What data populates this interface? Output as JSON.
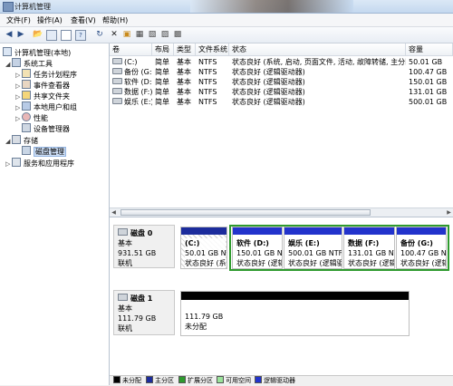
{
  "window": {
    "title": "计算机管理"
  },
  "menu": [
    "文件(F)",
    "操作(A)",
    "查看(V)",
    "帮助(H)"
  ],
  "toolbar": {
    "icons": [
      "back-icon",
      "forward-icon",
      "up-icon",
      "show-tree-icon",
      "properties-icon",
      "help-icon",
      "refresh-icon",
      "delete-icon",
      "folder-icon",
      "open-icon",
      "copy-icon",
      "cut-icon",
      "settings-icon"
    ]
  },
  "tree": {
    "root": "计算机管理(本地)",
    "system_tools": "系统工具",
    "items": [
      "任务计划程序",
      "事件查看器",
      "共享文件夹",
      "本地用户和组",
      "性能",
      "设备管理器"
    ],
    "storage": "存储",
    "disk_mgmt": "磁盘管理",
    "services": "服务和应用程序"
  },
  "volumes": {
    "headers": [
      "卷",
      "布局",
      "类型",
      "文件系统",
      "状态",
      "容量"
    ],
    "rows": [
      {
        "vol": "(C:)",
        "layout": "简单",
        "type": "基本",
        "fs": "NTFS",
        "status": "状态良好 (系统, 启动, 页面文件, 活动, 故障转储, 主分区)",
        "cap": "50.01 GB"
      },
      {
        "vol": "备份 (G:)",
        "layout": "简单",
        "type": "基本",
        "fs": "NTFS",
        "status": "状态良好 (逻辑驱动器)",
        "cap": "100.47 GB"
      },
      {
        "vol": "软件 (D:)",
        "layout": "简单",
        "type": "基本",
        "fs": "NTFS",
        "status": "状态良好 (逻辑驱动器)",
        "cap": "150.01 GB"
      },
      {
        "vol": "数据 (F:)",
        "layout": "简单",
        "type": "基本",
        "fs": "NTFS",
        "status": "状态良好 (逻辑驱动器)",
        "cap": "131.01 GB"
      },
      {
        "vol": "娱乐 (E:)",
        "layout": "简单",
        "type": "基本",
        "fs": "NTFS",
        "status": "状态良好 (逻辑驱动器)",
        "cap": "500.01 GB"
      }
    ]
  },
  "disk0": {
    "name": "磁盘 0",
    "type": "基本",
    "size": "931.51 GB",
    "status": "联机",
    "parts": [
      {
        "name": "(C:)",
        "size": "50.01 GB NTFS",
        "status": "状态良好 (系统"
      },
      {
        "name": "软件  (D:)",
        "size": "150.01 GB NT",
        "status": "状态良好 (逻辑"
      },
      {
        "name": "娱乐  (E:)",
        "size": "500.01 GB NTFS",
        "status": "状态良好 (逻辑驱动器)"
      },
      {
        "name": "数据  (F:)",
        "size": "131.01 GB NT",
        "status": "状态良好 (逻辑"
      },
      {
        "name": "备份  (G:)",
        "size": "100.47 GB NT",
        "status": "状态良好 (逻辑"
      }
    ]
  },
  "disk1": {
    "name": "磁盘 1",
    "type": "基本",
    "size": "111.79 GB",
    "status": "联机",
    "part": {
      "size": "111.79 GB",
      "status": "未分配"
    }
  },
  "legend": [
    {
      "label": "未分配",
      "color": "#000000"
    },
    {
      "label": "主分区",
      "color": "#1c2c9c"
    },
    {
      "label": "扩展分区",
      "color": "#2e9a2e"
    },
    {
      "label": "可用空间",
      "color": "#9be39b"
    },
    {
      "label": "逻辑驱动器",
      "color": "#2233cc"
    }
  ],
  "colors": {
    "primary": "#1c2c9c",
    "logical": "#2233cc",
    "extended": "#2e9a2e",
    "unallocated": "#000000"
  }
}
